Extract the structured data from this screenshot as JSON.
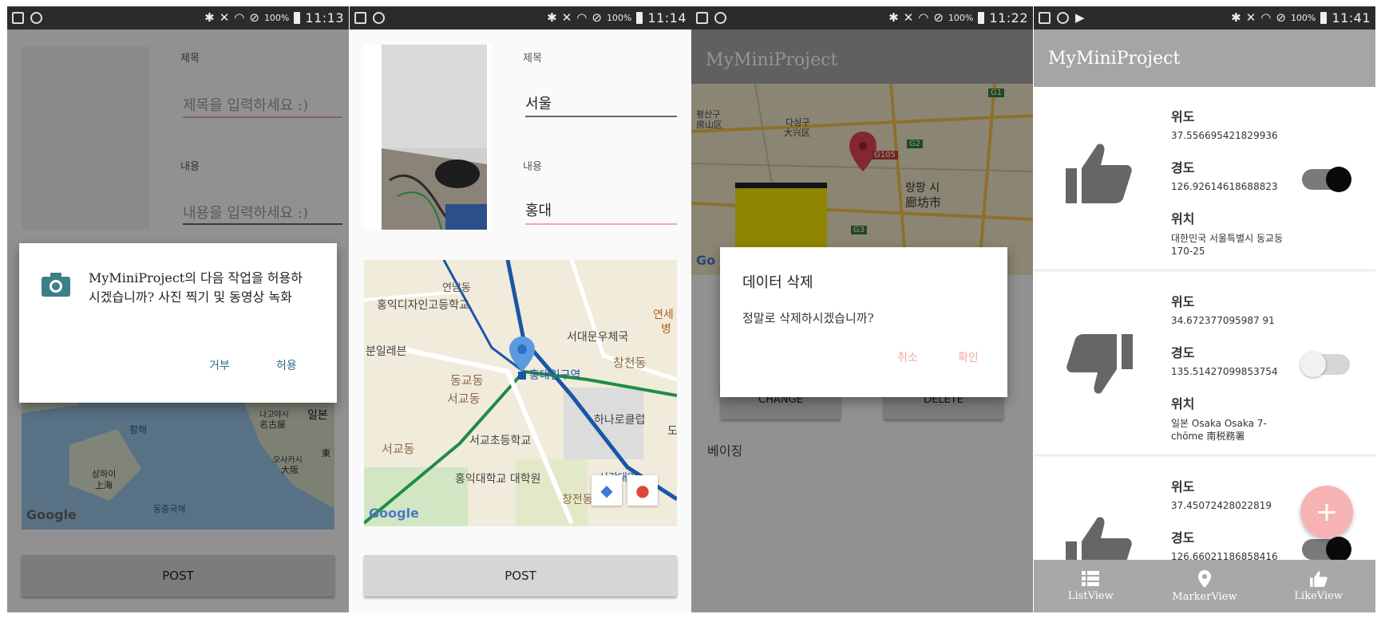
{
  "status": [
    {
      "percent": "100%",
      "time": "11:13"
    },
    {
      "percent": "100%",
      "time": "11:14"
    },
    {
      "percent": "100%",
      "time": "11:22"
    },
    {
      "percent": "100%",
      "time": "11:41"
    }
  ],
  "screen1": {
    "title_label": "제목",
    "title_placeholder": "제목을 입력하세요 :)",
    "content_label": "내용",
    "content_placeholder": "내용을 입력하세요 :)",
    "permission": {
      "message": "MyMiniProject의 다음 작업을 허용하시겠습니까? 사진 찍기 및 동영상 녹화",
      "deny": "거부",
      "allow": "허용"
    },
    "map_labels": [
      "황해",
      "상하이",
      "上海",
      "나고야시",
      "名古屋",
      "오사카시",
      "大阪",
      "일본",
      "東",
      "동중국해",
      "Google"
    ],
    "post_button": "POST"
  },
  "screen2": {
    "title_label": "제목",
    "title_value": "서울",
    "content_label": "내용",
    "content_value": "홍대",
    "map_labels": [
      "연남동",
      "홍익디자인고등학교",
      "연세",
      "병",
      "서대문우체국",
      "분일레븐",
      "창천동",
      "동교동",
      "홍대입구역",
      "서교동",
      "하나로클럽",
      "서교동",
      "서교초등학교",
      "홍익대학교 대학원",
      "서강대역",
      "창전동",
      "도",
      "Google"
    ],
    "post_button": "POST"
  },
  "screen3": {
    "app_title": "MyMiniProject",
    "map_labels": [
      "평산구",
      "房山区",
      "다싱구",
      "大兴区",
      "G1",
      "G2",
      "G105",
      "랑팡 시",
      "廊坊市",
      "G3",
      "Go"
    ],
    "dialog": {
      "title": "데이터 삭제",
      "message": "정말로 삭제하시겠습니까?",
      "cancel": "취소",
      "confirm": "확인"
    },
    "bg_buttons": [
      "CHANGE",
      "DELETE"
    ],
    "bg_text": "베이징"
  },
  "screen4": {
    "app_title": "MyMiniProject",
    "lat_label": "위도",
    "lng_label": "경도",
    "loc_label": "위치",
    "items": [
      {
        "icon": "thumb-up-icon",
        "lat": "37.556695421829936",
        "lng": "126.92614618688823",
        "loc": "대한민국 서울특별시 동교동 170-25",
        "liked": true
      },
      {
        "icon": "thumb-down-icon",
        "lat": "34.672377095987 91",
        "lng": "135.51427099853754",
        "loc": "일본 Osaka Osaka 7-chōme 南税務署",
        "liked": false
      },
      {
        "icon": "thumb-up-icon",
        "lat": "37.45072428022819",
        "lng": "126.66021186858416",
        "loc": "",
        "liked": true
      }
    ],
    "nav": [
      {
        "label": "ListView",
        "icon": "list-icon"
      },
      {
        "label": "MarkerView",
        "icon": "map-pin-icon"
      },
      {
        "label": "LikeView",
        "icon": "thumb-up-icon"
      }
    ],
    "fab_label": "+"
  },
  "colors": {
    "accent_pink": "#f3a5a5",
    "teal": "#3e7e87",
    "dialog_button": "#2d6f86",
    "appbar": "#a5a5a5"
  }
}
